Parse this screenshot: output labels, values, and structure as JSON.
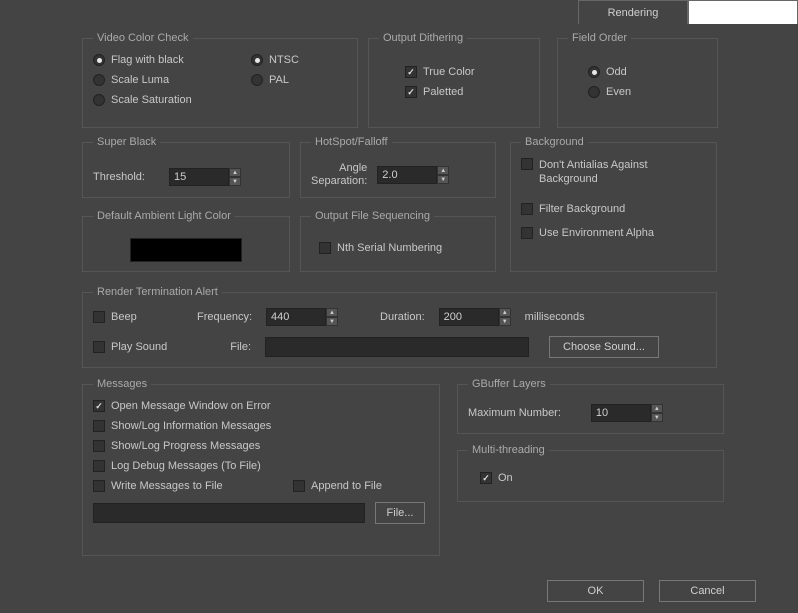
{
  "tabs": {
    "active": "Rendering"
  },
  "videoColorCheck": {
    "legend": "Video Color Check",
    "flagBlack": "Flag with black",
    "scaleLuma": "Scale Luma",
    "scaleSat": "Scale Saturation",
    "ntsc": "NTSC",
    "pal": "PAL"
  },
  "outputDithering": {
    "legend": "Output Dithering",
    "trueColor": "True Color",
    "paletted": "Paletted"
  },
  "fieldOrder": {
    "legend": "Field Order",
    "odd": "Odd",
    "even": "Even"
  },
  "superBlack": {
    "legend": "Super Black",
    "thresholdLabel": "Threshold:",
    "threshold": "15"
  },
  "hotspot": {
    "legend": "HotSpot/Falloff",
    "angleLabel1": "Angle",
    "angleLabel2": "Separation:",
    "value": "2.0"
  },
  "background": {
    "legend": "Background",
    "dontAA": "Don't Antialias Against Background",
    "filter": "Filter Background",
    "envAlpha": "Use Environment Alpha"
  },
  "ambient": {
    "legend": "Default Ambient Light Color"
  },
  "outputFileSeq": {
    "legend": "Output File Sequencing",
    "nth": "Nth Serial Numbering"
  },
  "termAlert": {
    "legend": "Render Termination Alert",
    "beep": "Beep",
    "playSound": "Play Sound",
    "frequencyLabel": "Frequency:",
    "frequency": "440",
    "durationLabel": "Duration:",
    "duration": "200",
    "ms": "milliseconds",
    "fileLabel": "File:",
    "fileValue": "",
    "chooseSound": "Choose Sound..."
  },
  "messages": {
    "legend": "Messages",
    "openOnError": "Open Message Window on Error",
    "showInfo": "Show/Log Information Messages",
    "showProgress": "Show/Log Progress Messages",
    "logDebug": "Log Debug Messages (To File)",
    "writeFile": "Write Messages to File",
    "append": "Append to File",
    "filePath": "",
    "fileBtn": "File..."
  },
  "gbuffer": {
    "legend": "GBuffer Layers",
    "maxLabel": "Maximum Number:",
    "value": "10"
  },
  "multithread": {
    "legend": "Multi-threading",
    "on": "On"
  },
  "buttons": {
    "ok": "OK",
    "cancel": "Cancel"
  }
}
